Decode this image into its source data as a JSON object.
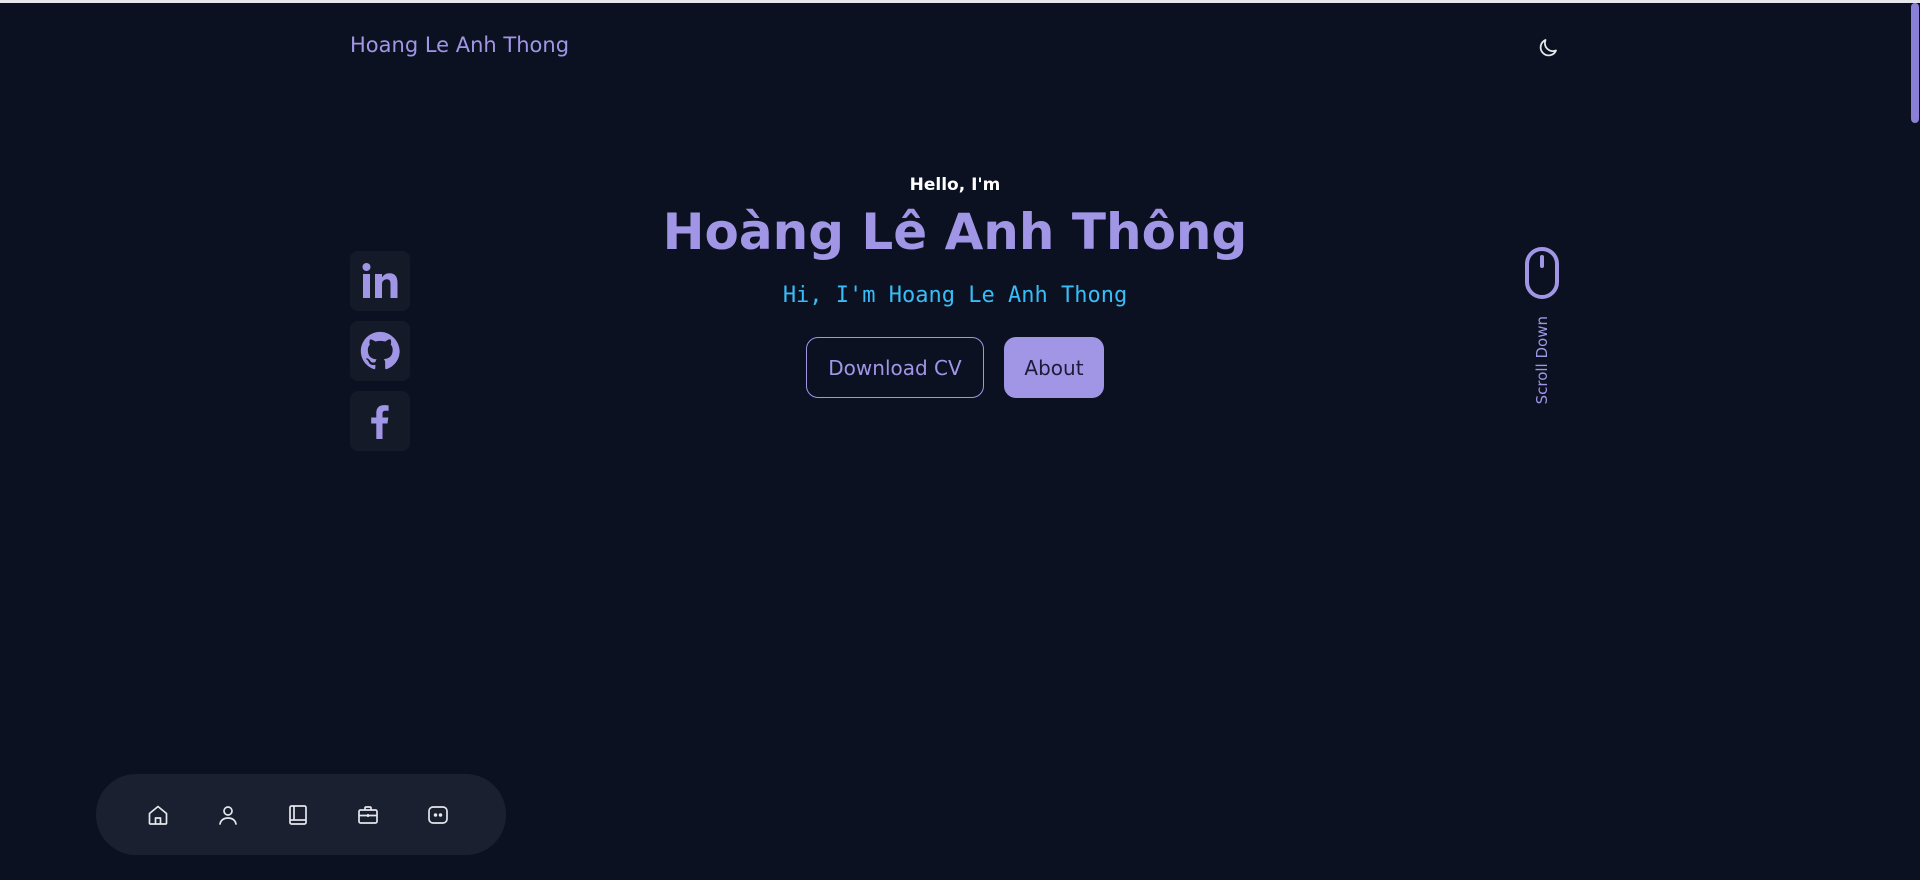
{
  "header": {
    "brand": "Hoang Le Anh Thong",
    "theme_icon": "moon-icon"
  },
  "hero": {
    "greeting": "Hello, I'm",
    "name": "Hoàng Lê Anh Thông",
    "typed_text": "Hi, I'm Hoang Le Anh Thong",
    "download_cv_label": "Download CV",
    "about_label": "About"
  },
  "social": [
    {
      "name": "linkedin",
      "icon": "linkedin-icon"
    },
    {
      "name": "github",
      "icon": "github-icon"
    },
    {
      "name": "facebook",
      "icon": "facebook-icon"
    }
  ],
  "scroll": {
    "label": "Scroll Down",
    "icon": "mouse-icon"
  },
  "bottom_nav": [
    {
      "icon": "home-icon"
    },
    {
      "icon": "user-icon"
    },
    {
      "icon": "book-icon"
    },
    {
      "icon": "briefcase-icon"
    },
    {
      "icon": "message-icon"
    }
  ],
  "colors": {
    "background": "#0b1120",
    "accent": "#a196e6",
    "typed": "#38bdf8",
    "surface": "#141a28"
  }
}
